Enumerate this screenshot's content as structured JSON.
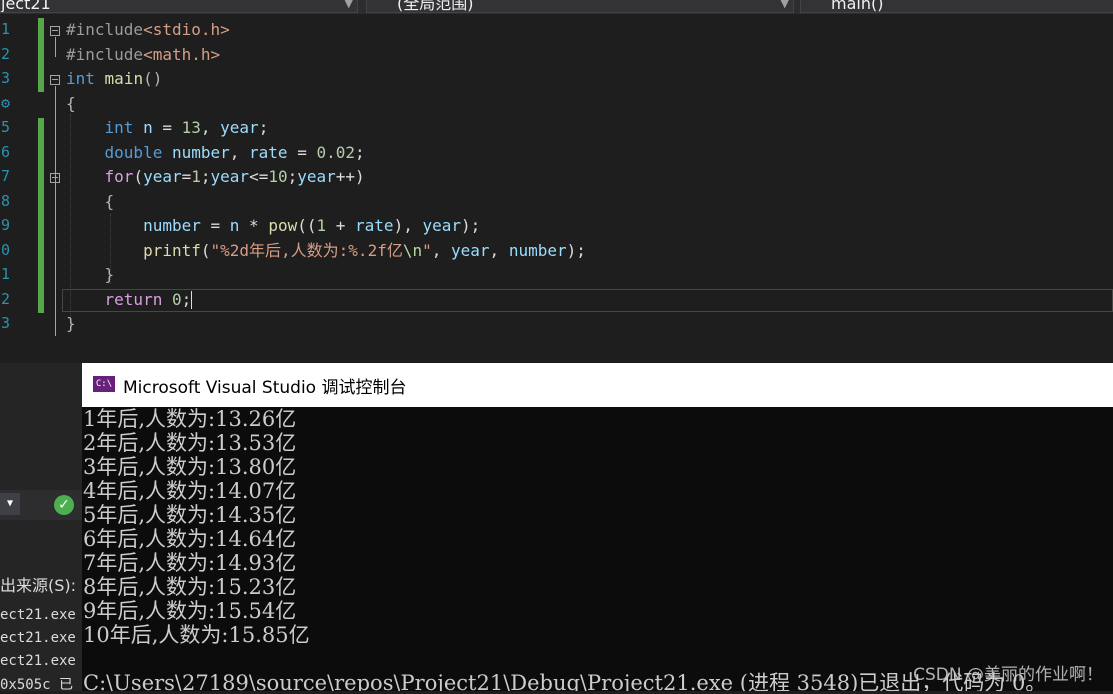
{
  "toolbar": {
    "project_combo": "ject21",
    "scope_combo": "(全局范围)",
    "function_combo": "main()"
  },
  "editor": {
    "line_numbers": [
      "1",
      "2",
      "3",
      "4",
      "5",
      "6",
      "7",
      "8",
      "9",
      "0",
      "1",
      "2",
      "3"
    ],
    "current_line": "return 0;"
  },
  "output_panel": {
    "source_label": "出来源(S):",
    "rows": [
      "ect21.exe",
      "ect21.exe",
      "ect21.exe",
      "0x505c 已"
    ]
  },
  "console": {
    "title": "Microsoft Visual Studio 调试控制台",
    "icon_text": "C:\\",
    "lines": [
      "1年后,人数为:13.26亿",
      "2年后,人数为:13.53亿",
      "3年后,人数为:13.80亿",
      "4年后,人数为:14.07亿",
      "5年后,人数为:14.35亿",
      "6年后,人数为:14.64亿",
      "7年后,人数为:14.93亿",
      "8年后,人数为:15.23亿",
      "9年后,人数为:15.54亿",
      "10年后,人数为:15.85亿"
    ],
    "exit_line": "C:\\Users\\27189\\source\\repos\\Project21\\Debug\\Project21.exe (进程 3548)已退出，代码为 0。"
  },
  "watermark": "CSDN @美丽的作业啊！",
  "colors": {
    "keyword": "#569cd6",
    "string": "#d69d85",
    "number": "#b5cea8",
    "console_bg": "#0c0c0c"
  }
}
